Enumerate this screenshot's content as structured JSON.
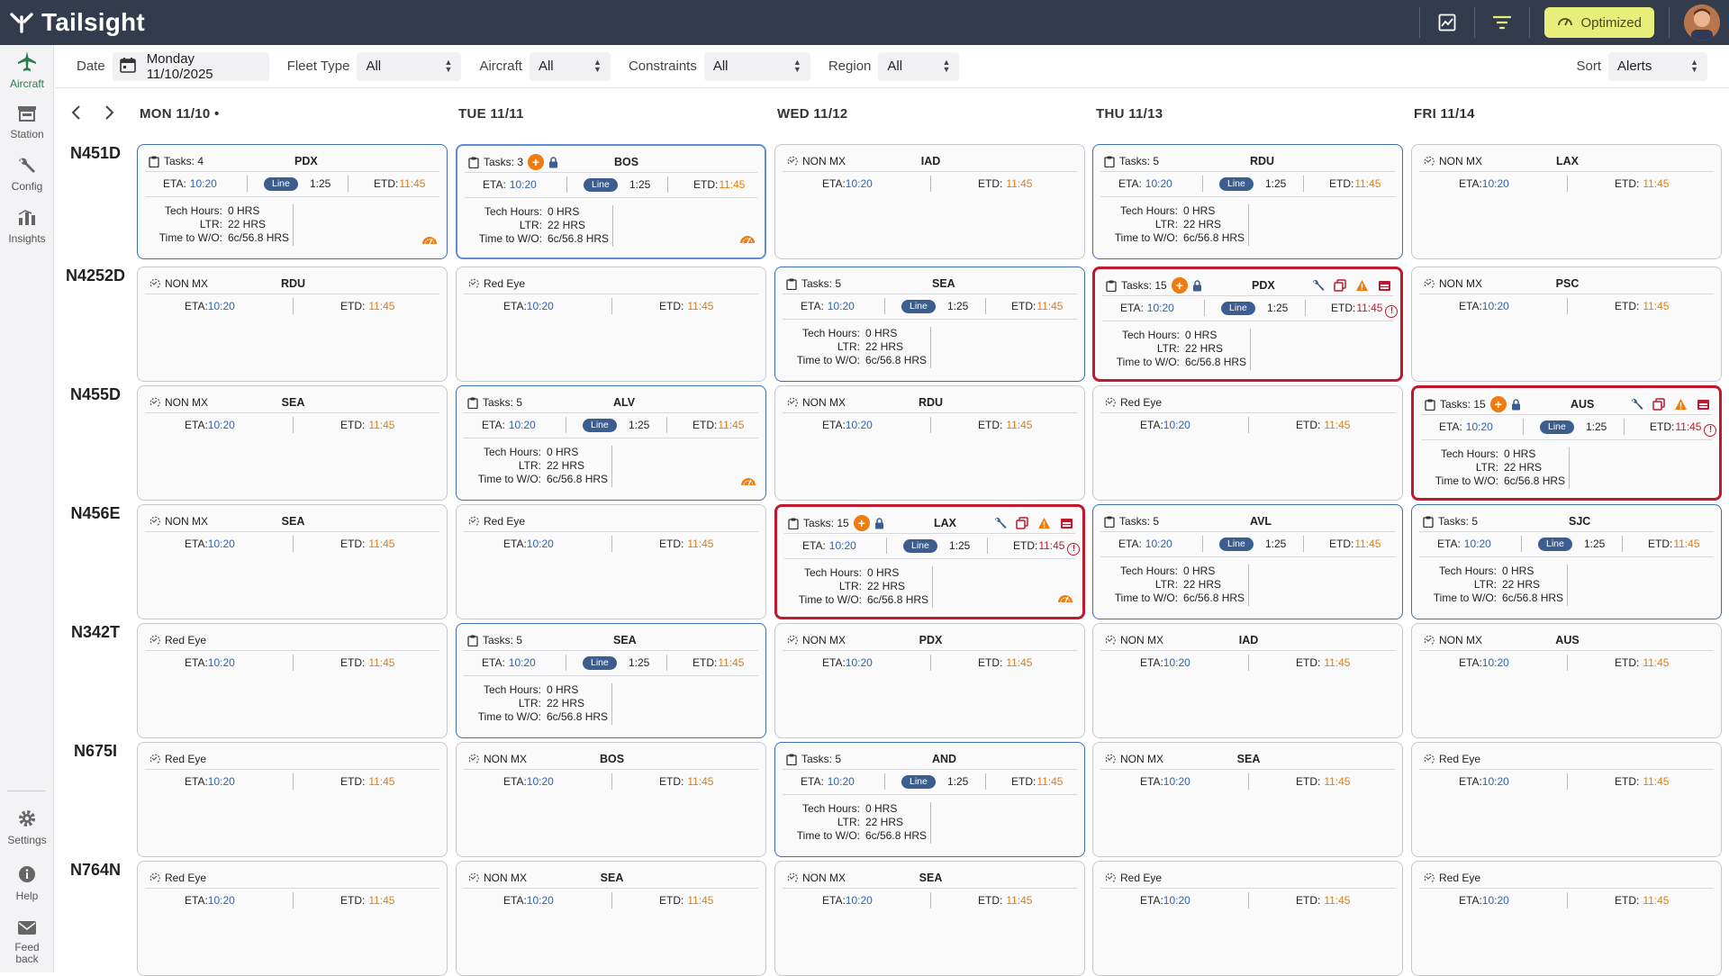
{
  "app": {
    "name": "Tailsight",
    "optimized_label": "Optimized"
  },
  "sidebar": {
    "items": [
      {
        "key": "aircraft",
        "label": "Aircraft",
        "icon": "airplane-icon",
        "active": true
      },
      {
        "key": "station",
        "label": "Station",
        "icon": "station-icon"
      },
      {
        "key": "config",
        "label": "Config",
        "icon": "wrench-icon"
      },
      {
        "key": "insights",
        "label": "Insights",
        "icon": "bar-chart-icon"
      }
    ],
    "bottom": [
      {
        "key": "settings",
        "label": "Settings",
        "icon": "gear-icon"
      },
      {
        "key": "help",
        "label": "Help",
        "icon": "info-icon"
      },
      {
        "key": "feedback",
        "label1": "Feed",
        "label2": "back",
        "icon": "mail-icon"
      }
    ]
  },
  "filters": {
    "date_label": "Date",
    "date_value": "Monday 11/10/2025",
    "fleet_label": "Fleet Type",
    "fleet_value": "All",
    "aircraft_label": "Aircraft",
    "aircraft_value": "All",
    "constraints_label": "Constraints",
    "constraints_value": "All",
    "region_label": "Region",
    "region_value": "All",
    "sort_label": "Sort",
    "sort_value": "Alerts"
  },
  "days": [
    "MON 11/10 •",
    "TUE 11/11",
    "WED 11/12",
    "THU 11/13",
    "FRI 11/14"
  ],
  "labels": {
    "eta": "ETA:",
    "etd": "ETD:",
    "line": "Line",
    "tech_hours": "Tech Hours:",
    "ltr": "LTR:",
    "time_to_wo": "Time to W/O:",
    "non_mx": "NON MX",
    "red_eye": "Red Eye",
    "tasks_prefix": "Tasks: "
  },
  "aircraft": [
    "N451D",
    "N4252D",
    "N455D",
    "N456E",
    "N342T",
    "N675I",
    "N764N"
  ],
  "colors": {
    "accent": "#2c7a4b",
    "eta": "#2f64b0",
    "etd": "#e07d10",
    "alert": "#c0182c",
    "line_pill": "#3c5d8f",
    "optimized": "#e8ee7a"
  },
  "grid": [
    [
      {
        "kind": "tasks",
        "tasks": "4",
        "station": "PDX",
        "eta": "10:20",
        "etd": "11:45",
        "dur": "1:25",
        "tech": "0 HRS",
        "ltr": "22 HRS",
        "wo": "6c/56.8 HRS",
        "border": "blue",
        "gauge": true
      },
      {
        "kind": "tasks",
        "tasks": "3",
        "plus": true,
        "lock": true,
        "station": "BOS",
        "eta": "10:20",
        "etd": "11:45",
        "dur": "1:25",
        "tech": "0 HRS",
        "ltr": "22 HRS",
        "wo": "6c/56.8 HRS",
        "border": "sel",
        "gauge": true
      },
      {
        "kind": "nonmx",
        "station": "IAD",
        "eta": "10:20",
        "etd": "11:45"
      },
      {
        "kind": "tasks",
        "tasks": "5",
        "station": "RDU",
        "eta": "10:20",
        "etd": "11:45",
        "dur": "1:25",
        "tech": "0 HRS",
        "ltr": "22 HRS",
        "wo": "6c/56.8 HRS",
        "border": "blue"
      },
      {
        "kind": "nonmx",
        "station": "LAX",
        "eta": "10:20",
        "etd": "11:45"
      }
    ],
    [
      {
        "kind": "nonmx",
        "station": "RDU",
        "eta": "10:20",
        "etd": "11:45"
      },
      {
        "kind": "redeye",
        "eta": "10:20",
        "etd": "11:45"
      },
      {
        "kind": "tasks",
        "tasks": "5",
        "station": "SEA",
        "eta": "10:20",
        "etd": "11:45",
        "dur": "1:25",
        "tech": "0 HRS",
        "ltr": "22 HRS",
        "wo": "6c/56.8 HRS",
        "border": "blue"
      },
      {
        "kind": "tasks",
        "tasks": "15",
        "plus": true,
        "lock": true,
        "alerts": true,
        "station": "PDX",
        "eta": "10:20",
        "etd": "11:45",
        "dur": "1:25",
        "tech": "0 HRS",
        "ltr": "22 HRS",
        "wo": "6c/56.8 HRS",
        "border": "red"
      },
      {
        "kind": "nonmx",
        "station": "PSC",
        "eta": "10:20",
        "etd": "11:45"
      }
    ],
    [
      {
        "kind": "nonmx",
        "station": "SEA",
        "eta": "10:20",
        "etd": "11:45"
      },
      {
        "kind": "tasks",
        "tasks": "5",
        "station": "ALV",
        "eta": "10:20",
        "etd": "11:45",
        "dur": "1:25",
        "tech": "0 HRS",
        "ltr": "22 HRS",
        "wo": "6c/56.8 HRS",
        "border": "blue",
        "gauge": true
      },
      {
        "kind": "nonmx",
        "station": "RDU",
        "eta": "10:20",
        "etd": "11:45"
      },
      {
        "kind": "redeye",
        "eta": "10:20",
        "etd": "11:45"
      },
      {
        "kind": "tasks",
        "tasks": "15",
        "plus": true,
        "lock": true,
        "alerts": true,
        "station": "AUS",
        "eta": "10:20",
        "etd": "11:45",
        "dur": "1:25",
        "tech": "0 HRS",
        "ltr": "22 HRS",
        "wo": "6c/56.8 HRS",
        "border": "red"
      }
    ],
    [
      {
        "kind": "nonmx",
        "station": "SEA",
        "eta": "10:20",
        "etd": "11:45"
      },
      {
        "kind": "redeye",
        "eta": "10:20",
        "etd": "11:45"
      },
      {
        "kind": "tasks",
        "tasks": "15",
        "plus": true,
        "lock": true,
        "alerts": true,
        "station": "LAX",
        "eta": "10:20",
        "etd": "11:45",
        "dur": "1:25",
        "tech": "0 HRS",
        "ltr": "22 HRS",
        "wo": "6c/56.8 HRS",
        "border": "red",
        "gauge": true
      },
      {
        "kind": "tasks",
        "tasks": "5",
        "station": "AVL",
        "eta": "10:20",
        "etd": "11:45",
        "dur": "1:25",
        "tech": "0 HRS",
        "ltr": "22 HRS",
        "wo": "6c/56.8 HRS",
        "border": "blue"
      },
      {
        "kind": "tasks",
        "tasks": "5",
        "station": "SJC",
        "eta": "10:20",
        "etd": "11:45",
        "dur": "1:25",
        "tech": "0 HRS",
        "ltr": "22 HRS",
        "wo": "6c/56.8 HRS",
        "border": "blue"
      }
    ],
    [
      {
        "kind": "redeye",
        "eta": "10:20",
        "etd": "11:45"
      },
      {
        "kind": "tasks",
        "tasks": "5",
        "station": "SEA",
        "eta": "10:20",
        "etd": "11:45",
        "dur": "1:25",
        "tech": "0 HRS",
        "ltr": "22 HRS",
        "wo": "6c/56.8 HRS",
        "border": "blue"
      },
      {
        "kind": "nonmx",
        "station": "PDX",
        "eta": "10:20",
        "etd": "11:45"
      },
      {
        "kind": "nonmx",
        "station": "IAD",
        "eta": "10:20",
        "etd": "11:45"
      },
      {
        "kind": "nonmx",
        "station": "AUS",
        "eta": "10:20",
        "etd": "11:45"
      }
    ],
    [
      {
        "kind": "redeye",
        "eta": "10:20",
        "etd": "11:45"
      },
      {
        "kind": "nonmx",
        "station": "BOS",
        "eta": "10:20",
        "etd": "11:45"
      },
      {
        "kind": "tasks",
        "tasks": "5",
        "station": "AND",
        "eta": "10:20",
        "etd": "11:45",
        "dur": "1:25",
        "tech": "0 HRS",
        "ltr": "22 HRS",
        "wo": "6c/56.8 HRS",
        "border": "blue"
      },
      {
        "kind": "nonmx",
        "station": "SEA",
        "eta": "10:20",
        "etd": "11:45"
      },
      {
        "kind": "redeye",
        "eta": "10:20",
        "etd": "11:45"
      }
    ],
    [
      {
        "kind": "redeye",
        "eta": "10:20",
        "etd": "11:45"
      },
      {
        "kind": "nonmx",
        "station": "SEA",
        "eta": "10:20",
        "etd": "11:45"
      },
      {
        "kind": "nonmx",
        "station": "SEA",
        "eta": "10:20",
        "etd": "11:45"
      },
      {
        "kind": "redeye",
        "eta": "10:20",
        "etd": "11:45"
      },
      {
        "kind": "redeye",
        "eta": "10:20",
        "etd": "11:45"
      }
    ]
  ]
}
